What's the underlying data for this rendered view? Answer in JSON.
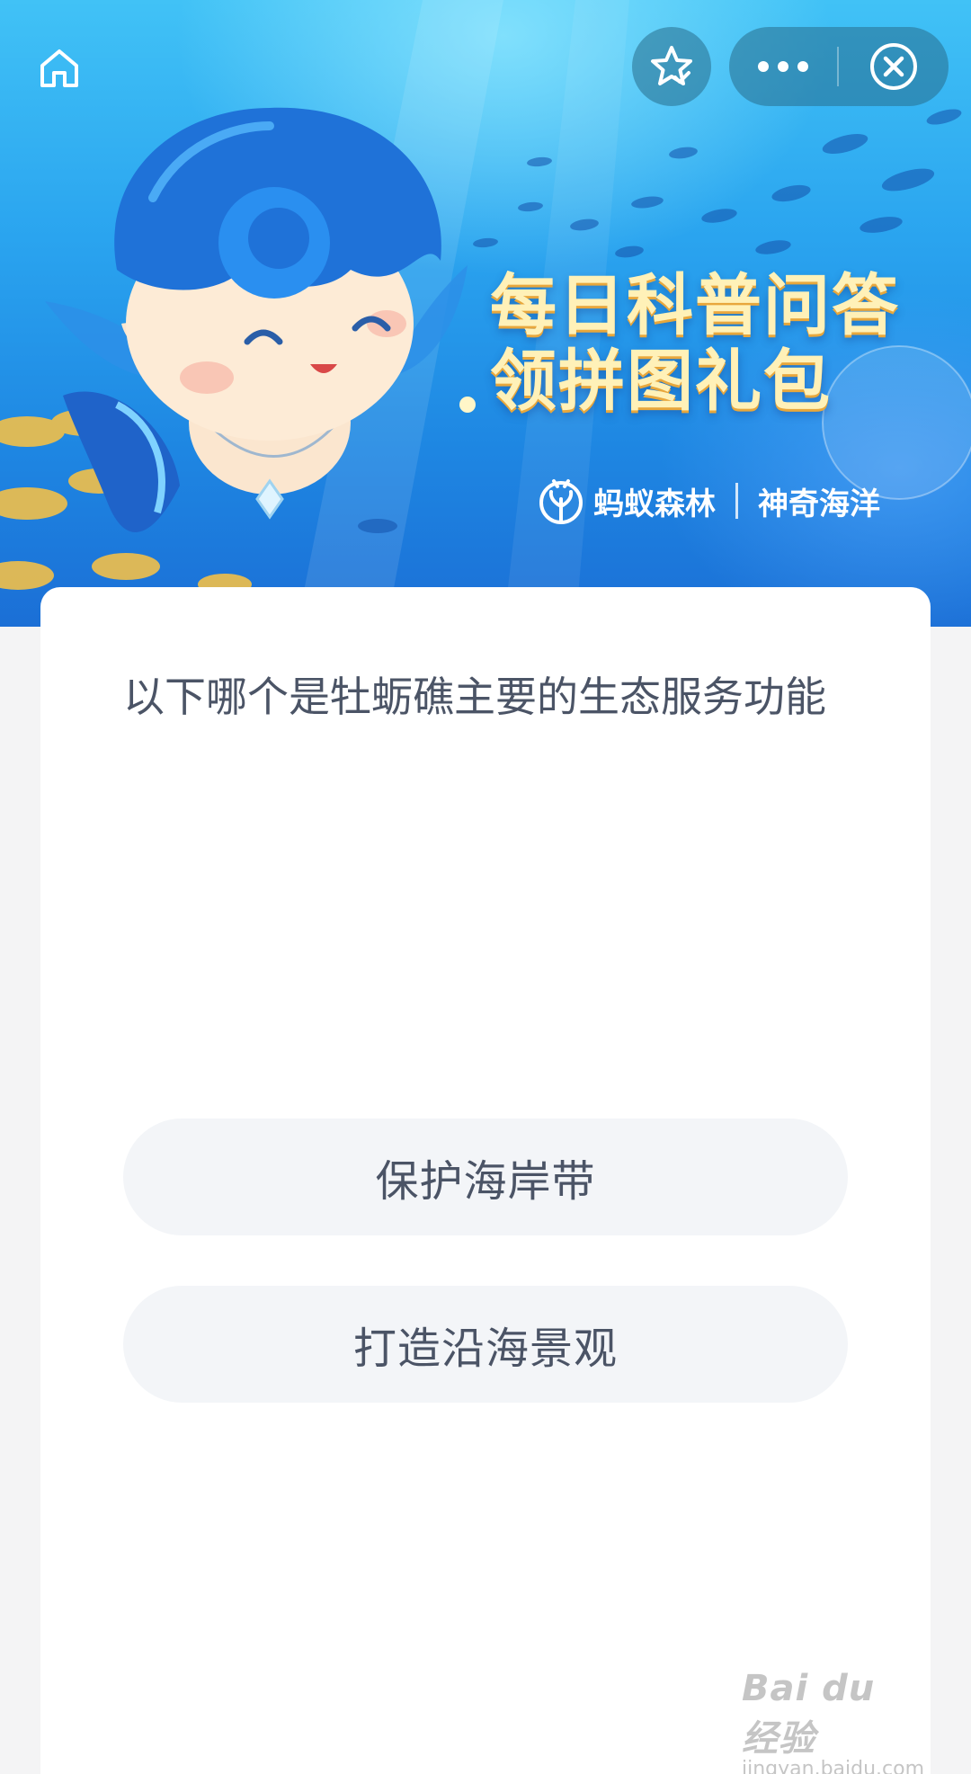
{
  "banner": {
    "title_line1": "每日科普问答",
    "title_line2": "领拼图礼包",
    "brand_left": "蚂蚁森林",
    "brand_right": "神奇海洋"
  },
  "nav": {
    "home_icon": "home-icon",
    "favorite_icon": "star-check-icon",
    "more_icon": "more-dots-icon",
    "close_icon": "close-circle-icon"
  },
  "quiz": {
    "question": "以下哪个是牡蛎礁主要的生态服务功能",
    "options": [
      {
        "label": "保护海岸带"
      },
      {
        "label": "打造沿海景观"
      }
    ]
  },
  "watermark": {
    "main": "Bai du 经验",
    "sub": "jingyan.baidu.com"
  },
  "colors": {
    "banner_top": "#41c2f6",
    "banner_bottom": "#1b6fd6",
    "title_text": "#fff1b8",
    "question_text": "#4b5466",
    "option_bg": "#f3f5f8",
    "page_bg": "#f4f4f5"
  }
}
